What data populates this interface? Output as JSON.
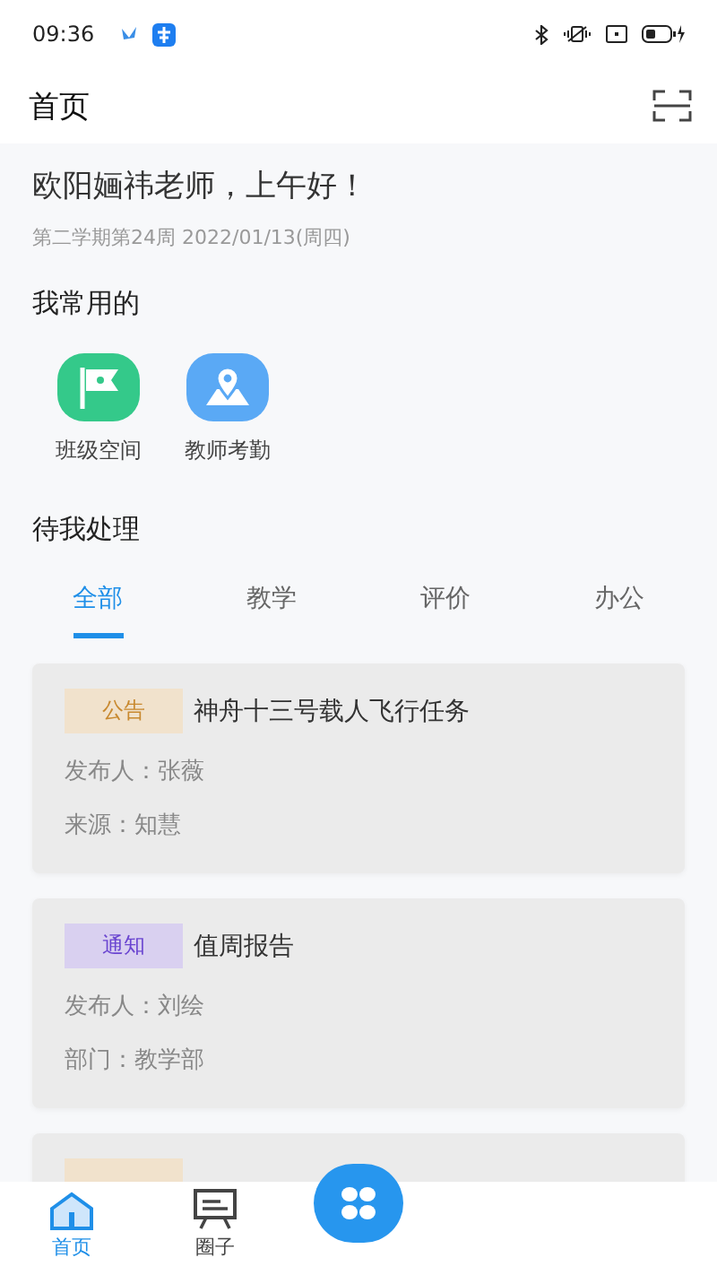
{
  "status_bar": {
    "time": "09:36"
  },
  "header": {
    "title": "首页"
  },
  "greeting": {
    "text": "欧阳婳祎老师，上午好！",
    "date": "第二学期第24周 2022/01/13(周四)"
  },
  "frequent": {
    "title": "我常用的",
    "items": [
      {
        "label": "班级空间",
        "kind": "flag"
      },
      {
        "label": "教师考勤",
        "kind": "location"
      }
    ]
  },
  "todo": {
    "title": "待我处理",
    "tabs": [
      {
        "label": "全部",
        "selected": true
      },
      {
        "label": "教学",
        "selected": false
      },
      {
        "label": "评价",
        "selected": false
      },
      {
        "label": "办公",
        "selected": false
      }
    ],
    "cards": [
      {
        "kind": "announcement",
        "tag": "公告",
        "title": "神舟十三号载人飞行任务",
        "lines": [
          "发布人：张薇",
          "来源：知慧"
        ]
      },
      {
        "kind": "notice",
        "tag": "通知",
        "title": "值周报告",
        "lines": [
          "发布人：刘绘",
          "部门：教学部"
        ]
      },
      {
        "kind": "announcement"
      }
    ]
  },
  "bottom_nav": {
    "items": [
      {
        "label": "首页",
        "kind": "home",
        "selected": true
      },
      {
        "label": "圈子",
        "kind": "board",
        "selected": false
      },
      {
        "kind": "apps",
        "selected": false
      }
    ]
  }
}
